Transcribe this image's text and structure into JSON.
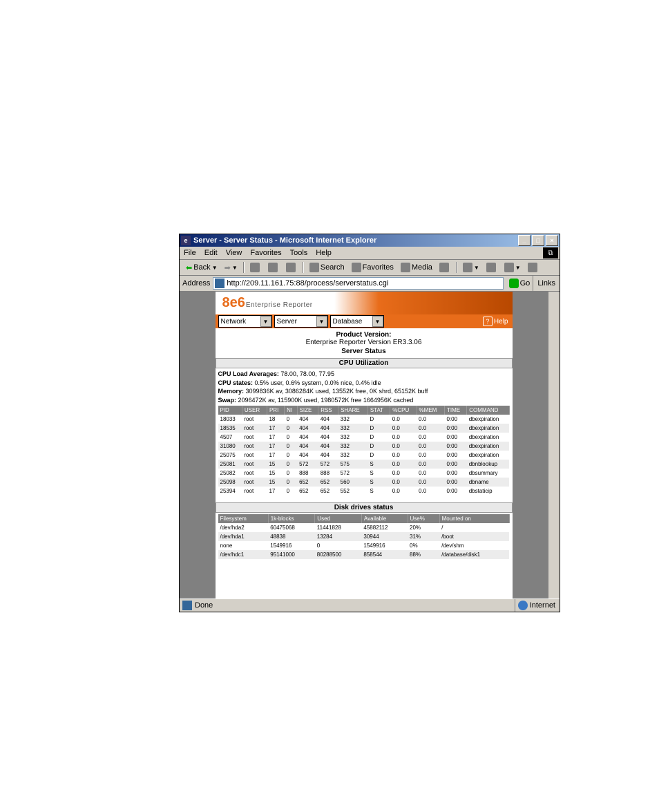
{
  "window": {
    "title": "Server - Server Status - Microsoft Internet Explorer"
  },
  "menubar": [
    "File",
    "Edit",
    "View",
    "Favorites",
    "Tools",
    "Help"
  ],
  "toolbar": {
    "back": "Back",
    "search": "Search",
    "favorites": "Favorites",
    "media": "Media"
  },
  "addressbar": {
    "label": "Address",
    "url": "http://209.11.161.75:88/process/serverstatus.cgi",
    "go": "Go",
    "links": "Links"
  },
  "banner": {
    "brand_big": "8e6",
    "brand_sub": "Enterprise Reporter"
  },
  "dropdowns": {
    "network": "Network",
    "server": "Server",
    "database": "Database",
    "help": "Help"
  },
  "product": {
    "pv_label": "Product Version:",
    "pv_value": "Enterprise Reporter Version ER3.3.06",
    "status_title": "Server Status"
  },
  "cpu_section": {
    "heading": "CPU Utilization",
    "load_label": "CPU Load Averages:",
    "load_value": "78.00, 78.00, 77.95",
    "states_label": "CPU states:",
    "states_value": "0.5% user, 0.6% system, 0.0% nice, 0.4% idle",
    "mem_label": "Memory:",
    "mem_value": "3099836K av, 3086284K used, 13552K free, 0K shrd, 65152K buff",
    "swap_label": "Swap:",
    "swap_value": "2096472K av, 115900K used, 1980572K free 1664956K cached"
  },
  "proc_table": {
    "headers": [
      "PID",
      "USER",
      "PRI",
      "NI",
      "SIZE",
      "RSS",
      "SHARE",
      "STAT",
      "%CPU",
      "%MEM",
      "TIME",
      "COMMAND"
    ],
    "rows": [
      [
        "18033",
        "root",
        "18",
        "0",
        "404",
        "404",
        "332",
        "D",
        "0.0",
        "0.0",
        "0:00",
        "dbexpiration"
      ],
      [
        "18535",
        "root",
        "17",
        "0",
        "404",
        "404",
        "332",
        "D",
        "0.0",
        "0.0",
        "0:00",
        "dbexpiration"
      ],
      [
        "4507",
        "root",
        "17",
        "0",
        "404",
        "404",
        "332",
        "D",
        "0.0",
        "0.0",
        "0:00",
        "dbexpiration"
      ],
      [
        "31080",
        "root",
        "17",
        "0",
        "404",
        "404",
        "332",
        "D",
        "0.0",
        "0.0",
        "0:00",
        "dbexpiration"
      ],
      [
        "25075",
        "root",
        "17",
        "0",
        "404",
        "404",
        "332",
        "D",
        "0.0",
        "0.0",
        "0:00",
        "dbexpiration"
      ],
      [
        "25081",
        "root",
        "15",
        "0",
        "572",
        "572",
        "575",
        "S",
        "0.0",
        "0.0",
        "0:00",
        "dbnblookup"
      ],
      [
        "25082",
        "root",
        "15",
        "0",
        "888",
        "888",
        "572",
        "S",
        "0.0",
        "0.0",
        "0:00",
        "dbsummary"
      ],
      [
        "25098",
        "root",
        "15",
        "0",
        "652",
        "652",
        "560",
        "S",
        "0.0",
        "0.0",
        "0:00",
        "dbname"
      ],
      [
        "25394",
        "root",
        "17",
        "0",
        "652",
        "652",
        "552",
        "S",
        "0.0",
        "0.0",
        "0:00",
        "dbstaticip"
      ]
    ]
  },
  "disk_section": {
    "heading": "Disk drives status",
    "headers": [
      "Filesystem",
      "1k-blocks",
      "Used",
      "Available",
      "Use%",
      "Mounted on"
    ],
    "rows": [
      [
        "/dev/hda2",
        "60475068",
        "11441828",
        "45882112",
        "20%",
        "/"
      ],
      [
        "/dev/hda1",
        "48838",
        "13284",
        "30944",
        "31%",
        "/boot"
      ],
      [
        "none",
        "1549916",
        "0",
        "1549916",
        "0%",
        "/dev/shm"
      ],
      [
        "/dev/hdc1",
        "95141000",
        "80288500",
        "858544",
        "88%",
        "/database/disk1"
      ]
    ]
  },
  "statusbar": {
    "done": "Done",
    "zone": "Internet"
  }
}
